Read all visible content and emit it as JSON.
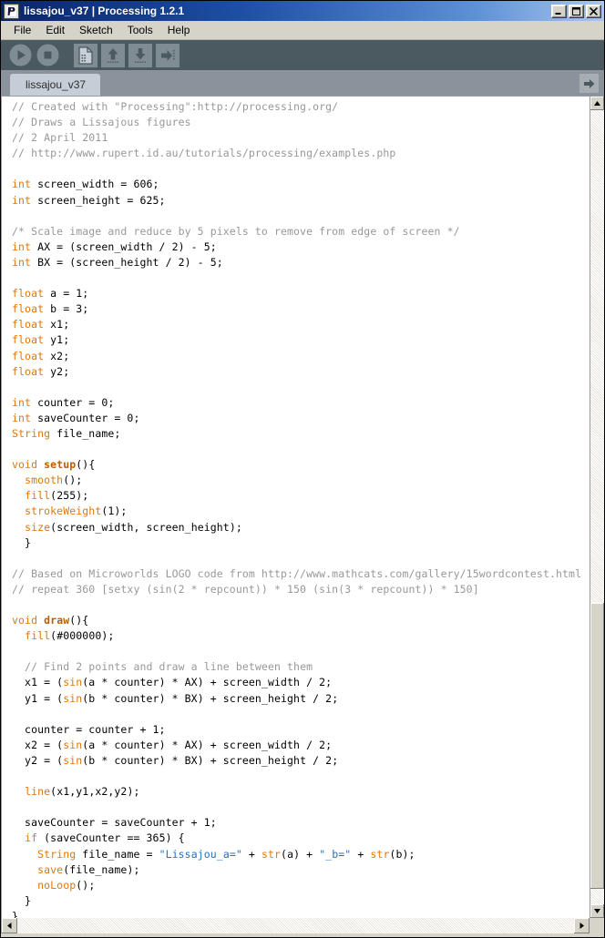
{
  "window": {
    "title": "lissajou_v37 | Processing 1.2.1",
    "icon": "processing-logo-icon",
    "controls": [
      {
        "name": "minimize-button",
        "label": "_"
      },
      {
        "name": "maximize-button",
        "label": "□"
      },
      {
        "name": "close-button",
        "label": "✕"
      }
    ]
  },
  "menubar": {
    "items": [
      {
        "label": "File"
      },
      {
        "label": "Edit"
      },
      {
        "label": "Sketch"
      },
      {
        "label": "Tools"
      },
      {
        "label": "Help"
      }
    ]
  },
  "toolbar": {
    "background": "#4b5a61",
    "buttons": [
      {
        "name": "run-button",
        "icon": "play-icon",
        "label": "Run"
      },
      {
        "name": "stop-button",
        "icon": "stop-icon",
        "label": "Stop"
      },
      {
        "name": "new-button",
        "icon": "new-file-icon",
        "label": "New"
      },
      {
        "name": "open-button",
        "icon": "open-up-arrow-icon",
        "label": "Open"
      },
      {
        "name": "save-button",
        "icon": "save-down-arrow-icon",
        "label": "Save"
      },
      {
        "name": "export-button",
        "icon": "export-right-arrow-icon",
        "label": "Export"
      }
    ]
  },
  "tabbar": {
    "tabs": [
      {
        "label": "lissajou_v37",
        "active": true
      }
    ],
    "menu_button": {
      "name": "tab-menu-button",
      "icon": "right-arrow-icon"
    }
  },
  "editor": {
    "colors": {
      "comment": "#989898",
      "keyword": "#e2770b",
      "function_bold": "#b85e00",
      "string": "#2a6ebb",
      "plain": "#000000",
      "background": "#ffffff"
    },
    "lines": [
      [
        [
          "comment",
          "// Created with \"Processing\":http://processing.org/"
        ]
      ],
      [
        [
          "comment",
          "// Draws a Lissajous figures"
        ]
      ],
      [
        [
          "comment",
          "// 2 April 2011"
        ]
      ],
      [
        [
          "comment",
          "// http://www.rupert.id.au/tutorials/processing/examples.php"
        ]
      ],
      [],
      [
        [
          "kw",
          "int"
        ],
        [
          "plain",
          " screen_width = 606;"
        ]
      ],
      [
        [
          "kw",
          "int"
        ],
        [
          "plain",
          " screen_height = 625;"
        ]
      ],
      [],
      [
        [
          "comment",
          "/* Scale image and reduce by 5 pixels to remove from edge of screen */"
        ]
      ],
      [
        [
          "kw",
          "int"
        ],
        [
          "plain",
          " AX = (screen_width / 2) - 5;"
        ]
      ],
      [
        [
          "kw",
          "int"
        ],
        [
          "plain",
          " BX = (screen_height / 2) - 5;"
        ]
      ],
      [],
      [
        [
          "kw",
          "float"
        ],
        [
          "plain",
          " a = 1;"
        ]
      ],
      [
        [
          "kw",
          "float"
        ],
        [
          "plain",
          " b = 3;"
        ]
      ],
      [
        [
          "kw",
          "float"
        ],
        [
          "plain",
          " x1;"
        ]
      ],
      [
        [
          "kw",
          "float"
        ],
        [
          "plain",
          " y1;"
        ]
      ],
      [
        [
          "kw",
          "float"
        ],
        [
          "plain",
          " x2;"
        ]
      ],
      [
        [
          "kw",
          "float"
        ],
        [
          "plain",
          " y2;"
        ]
      ],
      [],
      [
        [
          "kw",
          "int"
        ],
        [
          "plain",
          " counter = 0;"
        ]
      ],
      [
        [
          "kw",
          "int"
        ],
        [
          "plain",
          " saveCounter = 0;"
        ]
      ],
      [
        [
          "kw",
          "String"
        ],
        [
          "plain",
          " file_name;"
        ]
      ],
      [],
      [
        [
          "kw",
          "void"
        ],
        [
          "plain",
          " "
        ],
        [
          "fnbold",
          "setup"
        ],
        [
          "plain",
          "(){"
        ]
      ],
      [
        [
          "plain",
          "  "
        ],
        [
          "fn",
          "smooth"
        ],
        [
          "plain",
          "();"
        ]
      ],
      [
        [
          "plain",
          "  "
        ],
        [
          "fn",
          "fill"
        ],
        [
          "plain",
          "(255);"
        ]
      ],
      [
        [
          "plain",
          "  "
        ],
        [
          "fn",
          "strokeWeight"
        ],
        [
          "plain",
          "(1);"
        ]
      ],
      [
        [
          "plain",
          "  "
        ],
        [
          "fn",
          "size"
        ],
        [
          "plain",
          "(screen_width, screen_height);"
        ]
      ],
      [
        [
          "plain",
          "  }"
        ]
      ],
      [],
      [
        [
          "comment",
          "// Based on Microworlds LOGO code from http://www.mathcats.com/gallery/15wordcontest.html"
        ]
      ],
      [
        [
          "comment",
          "// repeat 360 [setxy (sin(2 * repcount)) * 150 (sin(3 * repcount)) * 150]"
        ]
      ],
      [],
      [
        [
          "kw",
          "void"
        ],
        [
          "plain",
          " "
        ],
        [
          "fnbold",
          "draw"
        ],
        [
          "plain",
          "(){"
        ]
      ],
      [
        [
          "plain",
          "  "
        ],
        [
          "fn",
          "fill"
        ],
        [
          "plain",
          "(#000000);"
        ]
      ],
      [],
      [
        [
          "plain",
          "  "
        ],
        [
          "comment",
          "// Find 2 points and draw a line between them"
        ]
      ],
      [
        [
          "plain",
          "  x1 = ("
        ],
        [
          "fn",
          "sin"
        ],
        [
          "plain",
          "(a * counter) * AX) + screen_width / 2;"
        ]
      ],
      [
        [
          "plain",
          "  y1 = ("
        ],
        [
          "fn",
          "sin"
        ],
        [
          "plain",
          "(b * counter) * BX) + screen_height / 2;"
        ]
      ],
      [],
      [
        [
          "plain",
          "  counter = counter + 1;"
        ]
      ],
      [
        [
          "plain",
          "  x2 = ("
        ],
        [
          "fn",
          "sin"
        ],
        [
          "plain",
          "(a * counter) * AX) + screen_width / 2;"
        ]
      ],
      [
        [
          "plain",
          "  y2 = ("
        ],
        [
          "fn",
          "sin"
        ],
        [
          "plain",
          "(b * counter) * BX) + screen_height / 2;"
        ]
      ],
      [],
      [
        [
          "plain",
          "  "
        ],
        [
          "fn",
          "line"
        ],
        [
          "plain",
          "(x1,y1,x2,y2);"
        ]
      ],
      [],
      [
        [
          "plain",
          "  saveCounter = saveCounter + 1;"
        ]
      ],
      [
        [
          "plain",
          "  "
        ],
        [
          "kw",
          "if"
        ],
        [
          "plain",
          " (saveCounter == 365) {"
        ]
      ],
      [
        [
          "plain",
          "    "
        ],
        [
          "kw",
          "String"
        ],
        [
          "plain",
          " file_name = "
        ],
        [
          "str",
          "\"Lissajou_a=\""
        ],
        [
          "plain",
          " + "
        ],
        [
          "fn",
          "str"
        ],
        [
          "plain",
          "(a) + "
        ],
        [
          "str",
          "\"_b=\""
        ],
        [
          "plain",
          " + "
        ],
        [
          "fn",
          "str"
        ],
        [
          "plain",
          "(b);"
        ]
      ],
      [
        [
          "plain",
          "    "
        ],
        [
          "fn",
          "save"
        ],
        [
          "plain",
          "(file_name);"
        ]
      ],
      [
        [
          "plain",
          "    "
        ],
        [
          "fn",
          "noLoop"
        ],
        [
          "plain",
          "();"
        ]
      ],
      [
        [
          "plain",
          "  }"
        ]
      ],
      [
        [
          "plain",
          "}"
        ]
      ]
    ]
  },
  "scrollbars": {
    "vertical": {
      "up_arrow": "scroll-up-arrow-icon",
      "down_arrow": "scroll-down-arrow-icon",
      "thumb_top_percent": 62,
      "thumb_height_percent": 36
    },
    "horizontal": {
      "left_arrow": "scroll-left-arrow-icon",
      "right_arrow": "scroll-right-arrow-icon"
    }
  }
}
